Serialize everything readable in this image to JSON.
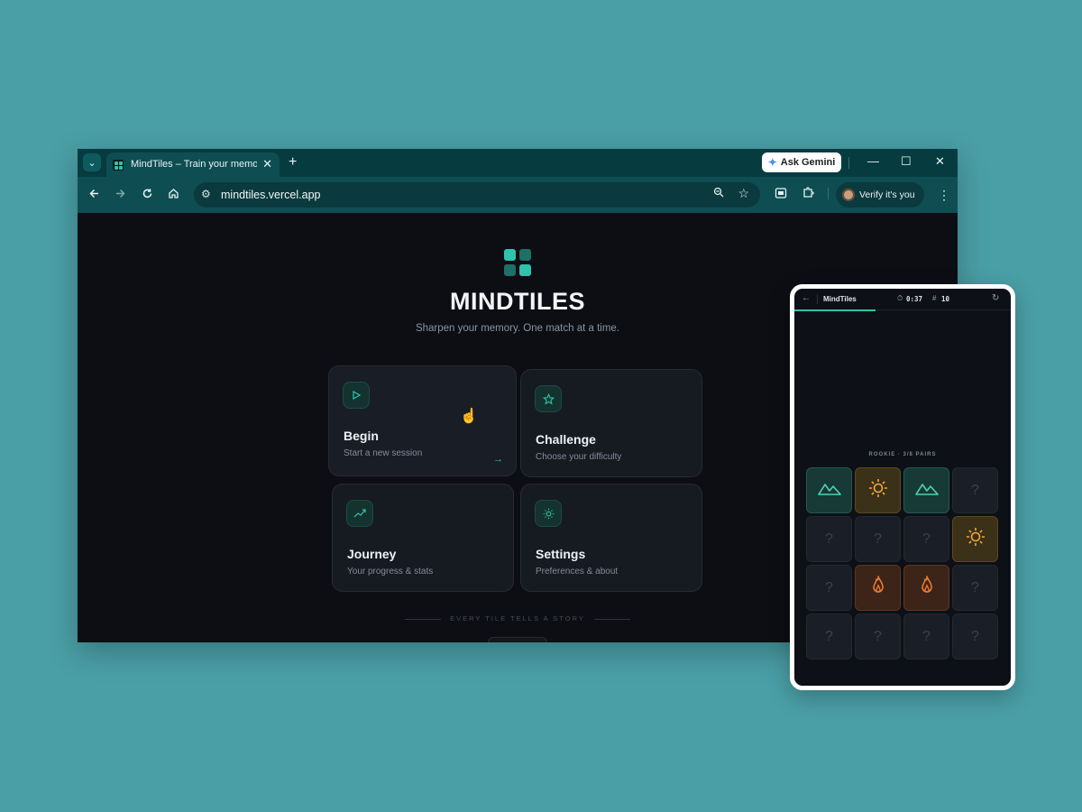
{
  "browser": {
    "tab_title": "MindTiles – Train your memory",
    "new_tab_glyph": "+",
    "ask_gemini_label": "Ask Gemini",
    "url": "mindtiles.vercel.app",
    "verify_label": "Verify it's you"
  },
  "app": {
    "brand": "MINDTILES",
    "tagline": "Sharpen your memory. One match at a time.",
    "accent_color": "#2fc3ad",
    "cards": [
      {
        "title": "Begin",
        "subtitle": "Start a new session",
        "icon": "play-icon"
      },
      {
        "title": "Challenge",
        "subtitle": "Choose your difficulty",
        "icon": "star-icon"
      },
      {
        "title": "Journey",
        "subtitle": "Your progress & stats",
        "icon": "trend-icon"
      },
      {
        "title": "Settings",
        "subtitle": "Preferences & about",
        "icon": "sun-icon"
      }
    ],
    "footer_caption": "EVERY TILE TELLS A STORY"
  },
  "phone": {
    "title": "MindTiles",
    "timer": "0:37",
    "moves": "10",
    "status": "ROOKIE · 3/8 PAIRS",
    "pairs_found": 3,
    "pairs_total": 8,
    "hidden_glyph": "?",
    "tiles": [
      [
        "mountain-icon",
        "sun-icon",
        "mountain-icon",
        "hidden"
      ],
      [
        "hidden",
        "hidden",
        "hidden",
        "sun-icon"
      ],
      [
        "hidden",
        "flame-icon",
        "flame-icon",
        "hidden"
      ],
      [
        "hidden",
        "hidden",
        "hidden",
        "hidden"
      ]
    ]
  }
}
